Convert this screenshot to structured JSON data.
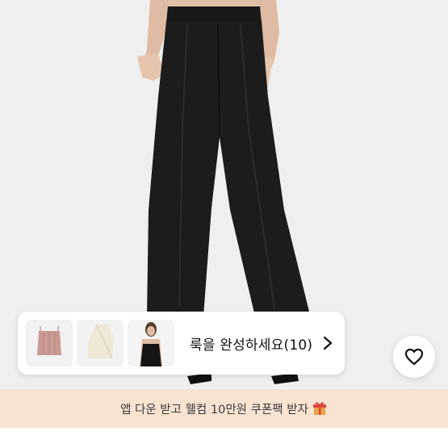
{
  "look": {
    "title": "룩을 완성하세요(10)",
    "thumbnails": [
      {
        "icon": "pink-corset-top-thumbnail"
      },
      {
        "icon": "white-halter-top-thumbnail"
      },
      {
        "icon": "black-camisole-model-thumbnail"
      }
    ]
  },
  "banner": {
    "text": "앱 다운 받고 웰컴 10만원 쿠폰팩 받자"
  },
  "colors": {
    "background": "#efefef",
    "banner": "#f8e3d2",
    "pants": "#1c1c1c"
  }
}
